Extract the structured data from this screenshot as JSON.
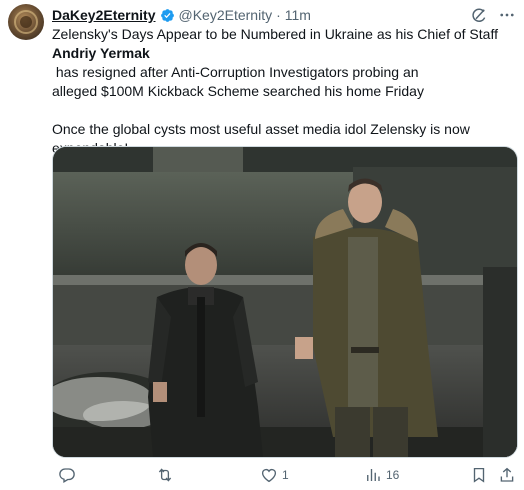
{
  "tweet": {
    "author_name": "DaKey2Eternity",
    "handle": "@Key2Eternity",
    "separator": "·",
    "time": "11m",
    "verified": true,
    "text_line1_prefix": "Zelensky's Days Appear to be Numbered in Ukraine as his Chief of Staff",
    "text_bold_name": "Andriy Yermak",
    "text_line2_suffix": " has resigned after Anti-Corruption Investigators probing an",
    "text_line3": "alleged $100M Kickback Scheme searched his home Friday",
    "text_para2_line1": "Once the global cysts most useful asset media idol Zelensky is now",
    "text_para2_line2": "expendable!"
  },
  "actions": {
    "reply_count": "",
    "repost_count": "",
    "like_count": "1",
    "views_count": "16"
  },
  "icons": {
    "verified": "verified-badge-icon",
    "grok": "grok-icon",
    "more": "more-dots-icon",
    "reply": "reply-icon",
    "repost": "repost-icon",
    "like": "heart-icon",
    "views": "views-bar-chart-icon",
    "bookmark": "bookmark-icon",
    "share": "share-icon"
  },
  "colors": {
    "text": "#0f1419",
    "secondary": "#536471",
    "verified_blue": "#1d9bf0"
  }
}
